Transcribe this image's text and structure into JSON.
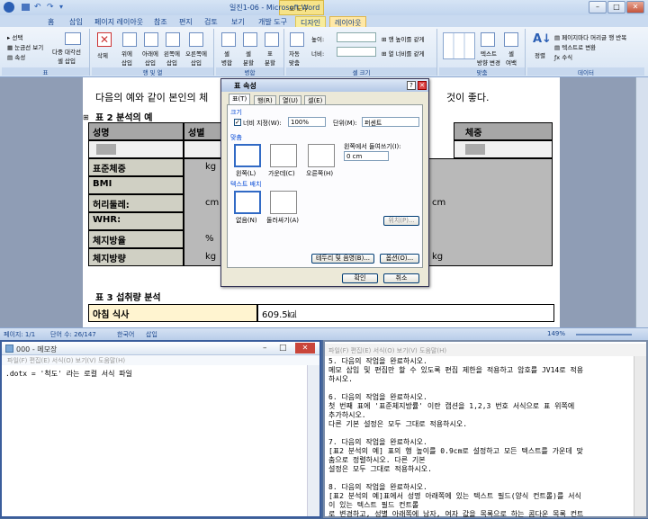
{
  "word": {
    "title": "일진1-06 - Microsoft Word",
    "context_label": "표 도구",
    "tabs": [
      "홈",
      "삽입",
      "페이지 레이아웃",
      "참조",
      "편지",
      "검토",
      "보기",
      "개발 도구",
      "디자인",
      "레이아웃"
    ],
    "ribbon": {
      "select": "선택",
      "gridlines": "눈금선 보기",
      "properties": "속성",
      "diagonal": "다중 대각선\n셀 삽입",
      "delete": "삭제",
      "insert_above": "위에\n삽입",
      "insert_below": "아래에\n삽입",
      "insert_left": "왼쪽에\n삽입",
      "insert_right": "오른쪽에\n삽입",
      "merge_cells": "셀\n병합",
      "split_cells": "셀\n분할",
      "split_table": "표\n분할",
      "autofit": "자동\n맞춤",
      "height_label": "높이:",
      "width_label": "너비:",
      "distribute_rows": "행 높이를 같게",
      "distribute_cols": "열 너비를 같게",
      "text_direction": "텍스트\n방향 변경",
      "cell_margins": "셀\n여백",
      "sort": "정렬",
      "repeat_header": "페이지마다 머리글 행 반복",
      "convert_text": "텍스트로 변환",
      "formula": "수식",
      "groups": [
        "표",
        "행 및 열",
        "병합",
        "셀 크기",
        "맞춤",
        "데이터"
      ]
    },
    "doc": {
      "intro": "다음의 예와 같이 본인의 체",
      "intro_end": "것이 좋다.",
      "table2_caption": "표 2 분석의 예",
      "t2_headers": [
        "성명",
        "성별",
        "체중"
      ],
      "t2_rows": [
        "표준체중",
        "BMI",
        "허리둘레:",
        "WHR:",
        "체지방율",
        "체지방량"
      ],
      "t2_units": [
        "kg",
        "cm",
        "%",
        "kg",
        "kg",
        "cm"
      ],
      "table3_caption": "표 3 섭취량 분석",
      "t3_row1_label": "아침 식사",
      "t3_row1_value": "609.5㎉"
    },
    "status": {
      "page": "페이지: 1/1",
      "words": "단어 수: 26/147",
      "lang": "한국어",
      "mode": "삽입",
      "zoom": "149%"
    }
  },
  "dialog": {
    "title": "표 속성",
    "tabs": [
      "표(T)",
      "행(R)",
      "열(U)",
      "셀(E)"
    ],
    "size_label": "크기",
    "preferred_width": "너비 지정(W):",
    "width_value": "100%",
    "unit_label": "단위(M):",
    "unit_value": "퍼센트",
    "alignment_label": "맞춤",
    "align_left": "왼쪽(L)",
    "align_center": "가운데(C)",
    "align_right": "오른쪽(H)",
    "indent_label": "왼쪽에서 들여쓰기(I):",
    "indent_value": "0 cm",
    "wrap_label": "텍스트 배치",
    "wrap_none": "없음(N)",
    "wrap_around": "둘러싸기(A)",
    "positioning": "위치(P)...",
    "borders": "테두리 및 음영(B)...",
    "options": "옵션(O)...",
    "ok": "확인",
    "cancel": "취소"
  },
  "notepad": {
    "title": "000 - 메모장",
    "menu": "파일(F)  편집(E)  서식(O)  보기(V)  도움말(H)",
    "content": ".dotx = '척도' 라는 로컬 서식 파일"
  },
  "task": {
    "menu": "파일(F)  편집(E)  서식(O)  보기(V)  도움말(H)",
    "lines": [
      "5. 다음의 작업을 완료하시오.",
      "   메모 삽입 및 편집만 할 수 있도록 편집 제한을 적용하고 암호를 JV14로 적용",
      "하시오.",
      "",
      "6. 다음의 작업을 완료하시오.",
      "   첫 번째 표에 '표준체지방률' 이란 캡션을 1,2,3 번호 서식으로 표 위쪽에",
      "추가하시오.",
      "   다른 기본 설정은 모두 그대로 적용하시오.",
      "",
      "7. 다음의 작업을 완료하시오.",
      "   [표2 분석의 예] 표의 행 높이를 0.9cm로 설정하고 모든 텍스트를 가운데 맞",
      "춤으로 정렬하시오. 다른 기본",
      "   설정은 모두 그대로 적용하시오.",
      "",
      "8. 다음의 작업을 완료하시오.",
      "   [표2 분석의 예]표에서 성명 아래쪽에 있는 텍스트 필드(양식 컨트롤)를 서식",
      "이 있는 텍스트 필드 컨트롤",
      "   로 변경하고, 성별 아래쪽에 남자, 여자 값을 목록으로 하는 콤다운 목록 컨트"
    ]
  }
}
